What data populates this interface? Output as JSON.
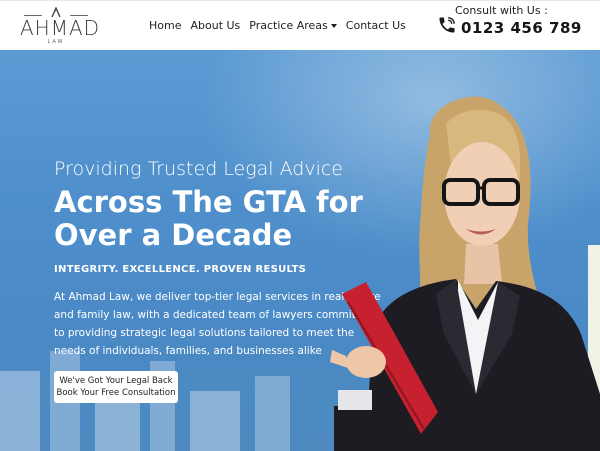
{
  "brand": {
    "name": "AHMAD",
    "sub": "LAW"
  },
  "nav": {
    "items": [
      {
        "label": "Home"
      },
      {
        "label": "About Us"
      },
      {
        "label": "Practice Areas"
      },
      {
        "label": "Contact Us"
      }
    ]
  },
  "contact": {
    "label": "Consult with Us :",
    "phone": "0123 456 789"
  },
  "hero": {
    "subtitle": "Providing Trusted Legal Advice",
    "title": "Across The GTA for Over a Decade",
    "tagline": "INTEGRITY. EXCELLENCE. PROVEN RESULTS",
    "description": "At Ahmad Law, we deliver top-tier legal services in real estate and family law, with a dedicated team of lawyers committed to providing strategic legal solutions tailored to meet the needs of individuals, families, and businesses alike",
    "cta_line1": "We've Got Your Legal Back",
    "cta_line2": "Book Your Free Consultation"
  },
  "colors": {
    "hero_blue": "#4f90cc",
    "folder_red": "#c7202e",
    "text_dark": "#1f1f1f"
  },
  "icons": {
    "phone": "phone-icon",
    "logo": "lambda-logo-icon",
    "dropdown": "caret-down-icon"
  }
}
